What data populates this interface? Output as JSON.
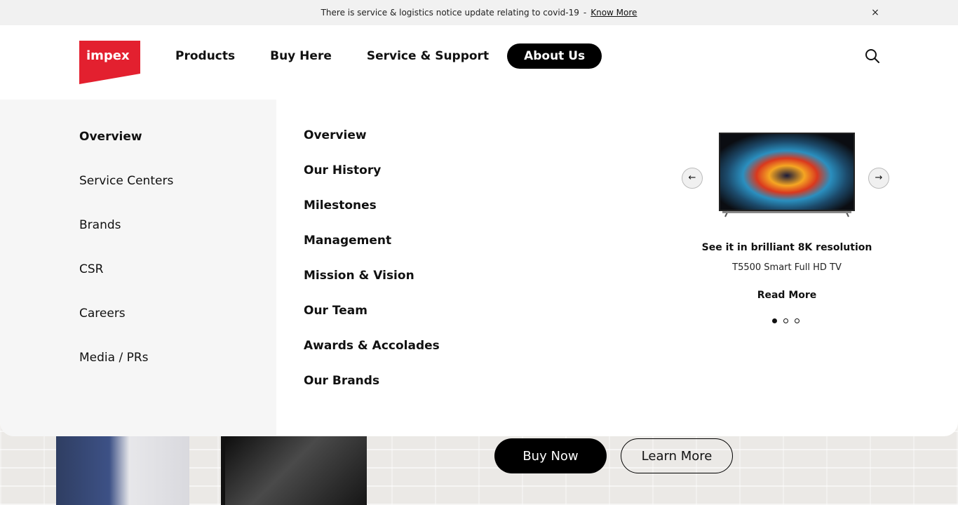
{
  "notice": {
    "text": "There is service & logistics notice update relating to covid-19",
    "separator": "-",
    "link": "Know More",
    "close": "×"
  },
  "brand": {
    "logo_text": "impex",
    "logo_color": "#e3202f"
  },
  "nav": {
    "items": [
      {
        "label": "Products"
      },
      {
        "label": "Buy Here"
      },
      {
        "label": "Service & Support"
      },
      {
        "label": "About Us",
        "active": true
      }
    ]
  },
  "about_menu": {
    "sections": [
      {
        "label": "Overview",
        "active": true
      },
      {
        "label": "Service Centers"
      },
      {
        "label": "Brands"
      },
      {
        "label": "CSR"
      },
      {
        "label": "Careers"
      },
      {
        "label": "Media / PRs"
      }
    ],
    "links": [
      {
        "label": "Overview"
      },
      {
        "label": "Our History"
      },
      {
        "label": "Milestones"
      },
      {
        "label": "Management"
      },
      {
        "label": "Mission & Vision"
      },
      {
        "label": "Our Team"
      },
      {
        "label": "Awards & Accolades"
      },
      {
        "label": "Our Brands"
      }
    ]
  },
  "promo": {
    "title": "See it in brilliant 8K resolution",
    "subtitle": "T5500 Smart Full HD TV",
    "cta": "Read More",
    "prev_icon": "←",
    "next_icon": "→",
    "slide_count": 3,
    "active_slide": 1
  },
  "hero": {
    "buy_label": "Buy Now",
    "learn_label": "Learn More"
  },
  "colors": {
    "accent": "#e3202f",
    "primary": "#000000",
    "panel_left_bg": "#f6f6f6",
    "notice_bg": "#f1f1f1"
  }
}
